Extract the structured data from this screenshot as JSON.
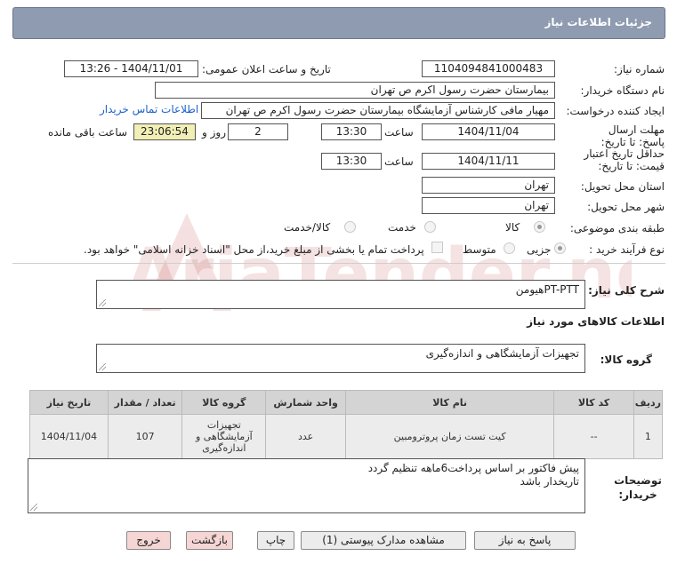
{
  "header": {
    "title": "جزئیات اطلاعات نیاز"
  },
  "watermark": {
    "text": "AriaTender.neT"
  },
  "form": {
    "need_number_label": "شماره نیاز:",
    "need_number": "1104094841000483",
    "announce_label": "تاریخ و ساعت اعلان عمومی:",
    "announce_value": "1404/11/01 - 13:26",
    "buyer_org_label": "نام دستگاه خریدار:",
    "buyer_org": "بیمارستان حضرت رسول اکرم ص  تهران",
    "requester_label": "ایجاد کننده درخواست:",
    "requester": "مهیار مافی کارشناس آزمایشگاه بیمارستان حضرت رسول اکرم ص  تهران",
    "contact_link": "اطلاعات تماس خریدار",
    "reply_deadline_label": "مهلت ارسال پاسخ: تا تاریخ:",
    "reply_date": "1404/11/04",
    "time_label": "ساعت",
    "reply_time": "13:30",
    "days_value": "2",
    "days_label": "روز و",
    "remaining_time": "23:06:54",
    "remaining_label": "ساعت باقی مانده",
    "price_validity_label": "حداقل تاریخ اعتبار قیمت: تا تاریخ:",
    "validity_date": "1404/11/11",
    "validity_time": "13:30",
    "province_label": "استان محل تحویل:",
    "province": "تهران",
    "city_label": "شهر محل تحویل:",
    "city": "تهران",
    "category_label": "طبقه بندی موضوعی:",
    "category_options": [
      "کالا",
      "خدمت",
      "کالا/خدمت"
    ],
    "category_selected": "کالا",
    "purchase_type_label": "نوع فرآیند خرید :",
    "purchase_options": [
      "جزیی",
      "متوسط"
    ],
    "payment_note": "پرداخت تمام یا بخشی از مبلغ خرید،از محل \"اسناد خزانه اسلامی\" خواهد بود."
  },
  "description": {
    "label": "شرح کلی نیاز:",
    "value": "PT-PTTهیومن"
  },
  "goods_info": {
    "title": "اطلاعات کالاهای مورد نیاز",
    "group_label": "گروه کالا:",
    "group_value": "تجهیزات آزمایشگاهی و اندازه‌گیری"
  },
  "table": {
    "headers": [
      "ردیف",
      "کد کالا",
      "نام کالا",
      "واحد شمارش",
      "گروه کالا",
      "تعداد / مقدار",
      "تاریخ نیاز"
    ],
    "rows": [
      [
        "1",
        "--",
        "کیت تست زمان پروترومبین",
        "عدد",
        "تجهیزات آزمایشگاهی و اندازه‌گیری",
        "107",
        "1404/11/04"
      ]
    ]
  },
  "notes": {
    "label_line1": "توضیحات",
    "label_line2": "خریدار:",
    "line1": "پیش فاکتور بر اساس پرداخت6ماهه تنظیم گردد",
    "line2": "تاریخدار باشد"
  },
  "buttons": {
    "reply": "پاسخ به نیاز",
    "view_docs": "مشاهده مدارک پیوستی (1)",
    "print": "چاپ",
    "back": "بازگشت",
    "exit": "خروج"
  }
}
